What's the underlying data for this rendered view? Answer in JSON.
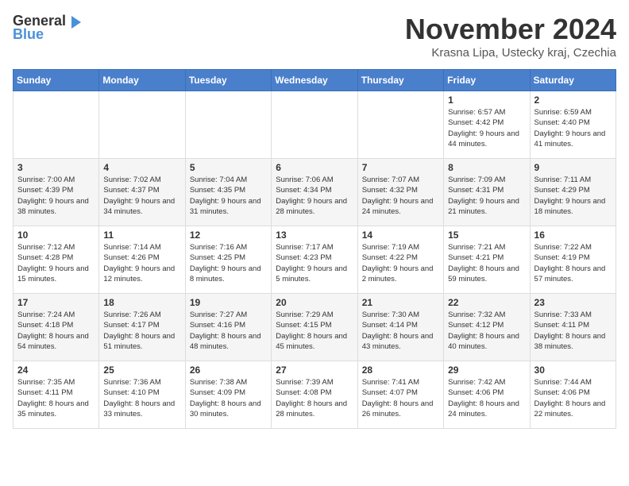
{
  "logo": {
    "general": "General",
    "blue": "Blue"
  },
  "title": {
    "month": "November 2024",
    "location": "Krasna Lipa, Ustecky kraj, Czechia"
  },
  "headers": [
    "Sunday",
    "Monday",
    "Tuesday",
    "Wednesday",
    "Thursday",
    "Friday",
    "Saturday"
  ],
  "weeks": [
    [
      {
        "day": "",
        "info": ""
      },
      {
        "day": "",
        "info": ""
      },
      {
        "day": "",
        "info": ""
      },
      {
        "day": "",
        "info": ""
      },
      {
        "day": "",
        "info": ""
      },
      {
        "day": "1",
        "info": "Sunrise: 6:57 AM\nSunset: 4:42 PM\nDaylight: 9 hours and 44 minutes."
      },
      {
        "day": "2",
        "info": "Sunrise: 6:59 AM\nSunset: 4:40 PM\nDaylight: 9 hours and 41 minutes."
      }
    ],
    [
      {
        "day": "3",
        "info": "Sunrise: 7:00 AM\nSunset: 4:39 PM\nDaylight: 9 hours and 38 minutes."
      },
      {
        "day": "4",
        "info": "Sunrise: 7:02 AM\nSunset: 4:37 PM\nDaylight: 9 hours and 34 minutes."
      },
      {
        "day": "5",
        "info": "Sunrise: 7:04 AM\nSunset: 4:35 PM\nDaylight: 9 hours and 31 minutes."
      },
      {
        "day": "6",
        "info": "Sunrise: 7:06 AM\nSunset: 4:34 PM\nDaylight: 9 hours and 28 minutes."
      },
      {
        "day": "7",
        "info": "Sunrise: 7:07 AM\nSunset: 4:32 PM\nDaylight: 9 hours and 24 minutes."
      },
      {
        "day": "8",
        "info": "Sunrise: 7:09 AM\nSunset: 4:31 PM\nDaylight: 9 hours and 21 minutes."
      },
      {
        "day": "9",
        "info": "Sunrise: 7:11 AM\nSunset: 4:29 PM\nDaylight: 9 hours and 18 minutes."
      }
    ],
    [
      {
        "day": "10",
        "info": "Sunrise: 7:12 AM\nSunset: 4:28 PM\nDaylight: 9 hours and 15 minutes."
      },
      {
        "day": "11",
        "info": "Sunrise: 7:14 AM\nSunset: 4:26 PM\nDaylight: 9 hours and 12 minutes."
      },
      {
        "day": "12",
        "info": "Sunrise: 7:16 AM\nSunset: 4:25 PM\nDaylight: 9 hours and 8 minutes."
      },
      {
        "day": "13",
        "info": "Sunrise: 7:17 AM\nSunset: 4:23 PM\nDaylight: 9 hours and 5 minutes."
      },
      {
        "day": "14",
        "info": "Sunrise: 7:19 AM\nSunset: 4:22 PM\nDaylight: 9 hours and 2 minutes."
      },
      {
        "day": "15",
        "info": "Sunrise: 7:21 AM\nSunset: 4:21 PM\nDaylight: 8 hours and 59 minutes."
      },
      {
        "day": "16",
        "info": "Sunrise: 7:22 AM\nSunset: 4:19 PM\nDaylight: 8 hours and 57 minutes."
      }
    ],
    [
      {
        "day": "17",
        "info": "Sunrise: 7:24 AM\nSunset: 4:18 PM\nDaylight: 8 hours and 54 minutes."
      },
      {
        "day": "18",
        "info": "Sunrise: 7:26 AM\nSunset: 4:17 PM\nDaylight: 8 hours and 51 minutes."
      },
      {
        "day": "19",
        "info": "Sunrise: 7:27 AM\nSunset: 4:16 PM\nDaylight: 8 hours and 48 minutes."
      },
      {
        "day": "20",
        "info": "Sunrise: 7:29 AM\nSunset: 4:15 PM\nDaylight: 8 hours and 45 minutes."
      },
      {
        "day": "21",
        "info": "Sunrise: 7:30 AM\nSunset: 4:14 PM\nDaylight: 8 hours and 43 minutes."
      },
      {
        "day": "22",
        "info": "Sunrise: 7:32 AM\nSunset: 4:12 PM\nDaylight: 8 hours and 40 minutes."
      },
      {
        "day": "23",
        "info": "Sunrise: 7:33 AM\nSunset: 4:11 PM\nDaylight: 8 hours and 38 minutes."
      }
    ],
    [
      {
        "day": "24",
        "info": "Sunrise: 7:35 AM\nSunset: 4:11 PM\nDaylight: 8 hours and 35 minutes."
      },
      {
        "day": "25",
        "info": "Sunrise: 7:36 AM\nSunset: 4:10 PM\nDaylight: 8 hours and 33 minutes."
      },
      {
        "day": "26",
        "info": "Sunrise: 7:38 AM\nSunset: 4:09 PM\nDaylight: 8 hours and 30 minutes."
      },
      {
        "day": "27",
        "info": "Sunrise: 7:39 AM\nSunset: 4:08 PM\nDaylight: 8 hours and 28 minutes."
      },
      {
        "day": "28",
        "info": "Sunrise: 7:41 AM\nSunset: 4:07 PM\nDaylight: 8 hours and 26 minutes."
      },
      {
        "day": "29",
        "info": "Sunrise: 7:42 AM\nSunset: 4:06 PM\nDaylight: 8 hours and 24 minutes."
      },
      {
        "day": "30",
        "info": "Sunrise: 7:44 AM\nSunset: 4:06 PM\nDaylight: 8 hours and 22 minutes."
      }
    ]
  ]
}
